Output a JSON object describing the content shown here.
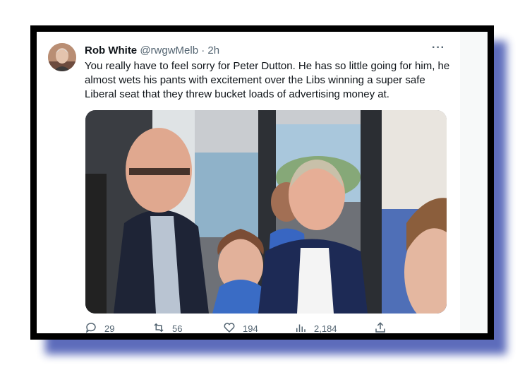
{
  "tweet": {
    "author_name": "Rob White",
    "meta": "@rwgwMelb · 2h",
    "text": "You really have to feel sorry for Peter Dutton. He has so little going for him, he almost wets his pants with excitement over the Libs winning a super safe Liberal seat that they threw bucket loads of advertising money at.",
    "more_icon": "more-horizontal-icon"
  },
  "actions": {
    "replies": "29",
    "retweets": "56",
    "likes": "194",
    "views": "2,184"
  },
  "colors": {
    "frame": "#000000",
    "shadow": "#5565b8",
    "text": "#0f1419",
    "secondary": "#536471"
  }
}
